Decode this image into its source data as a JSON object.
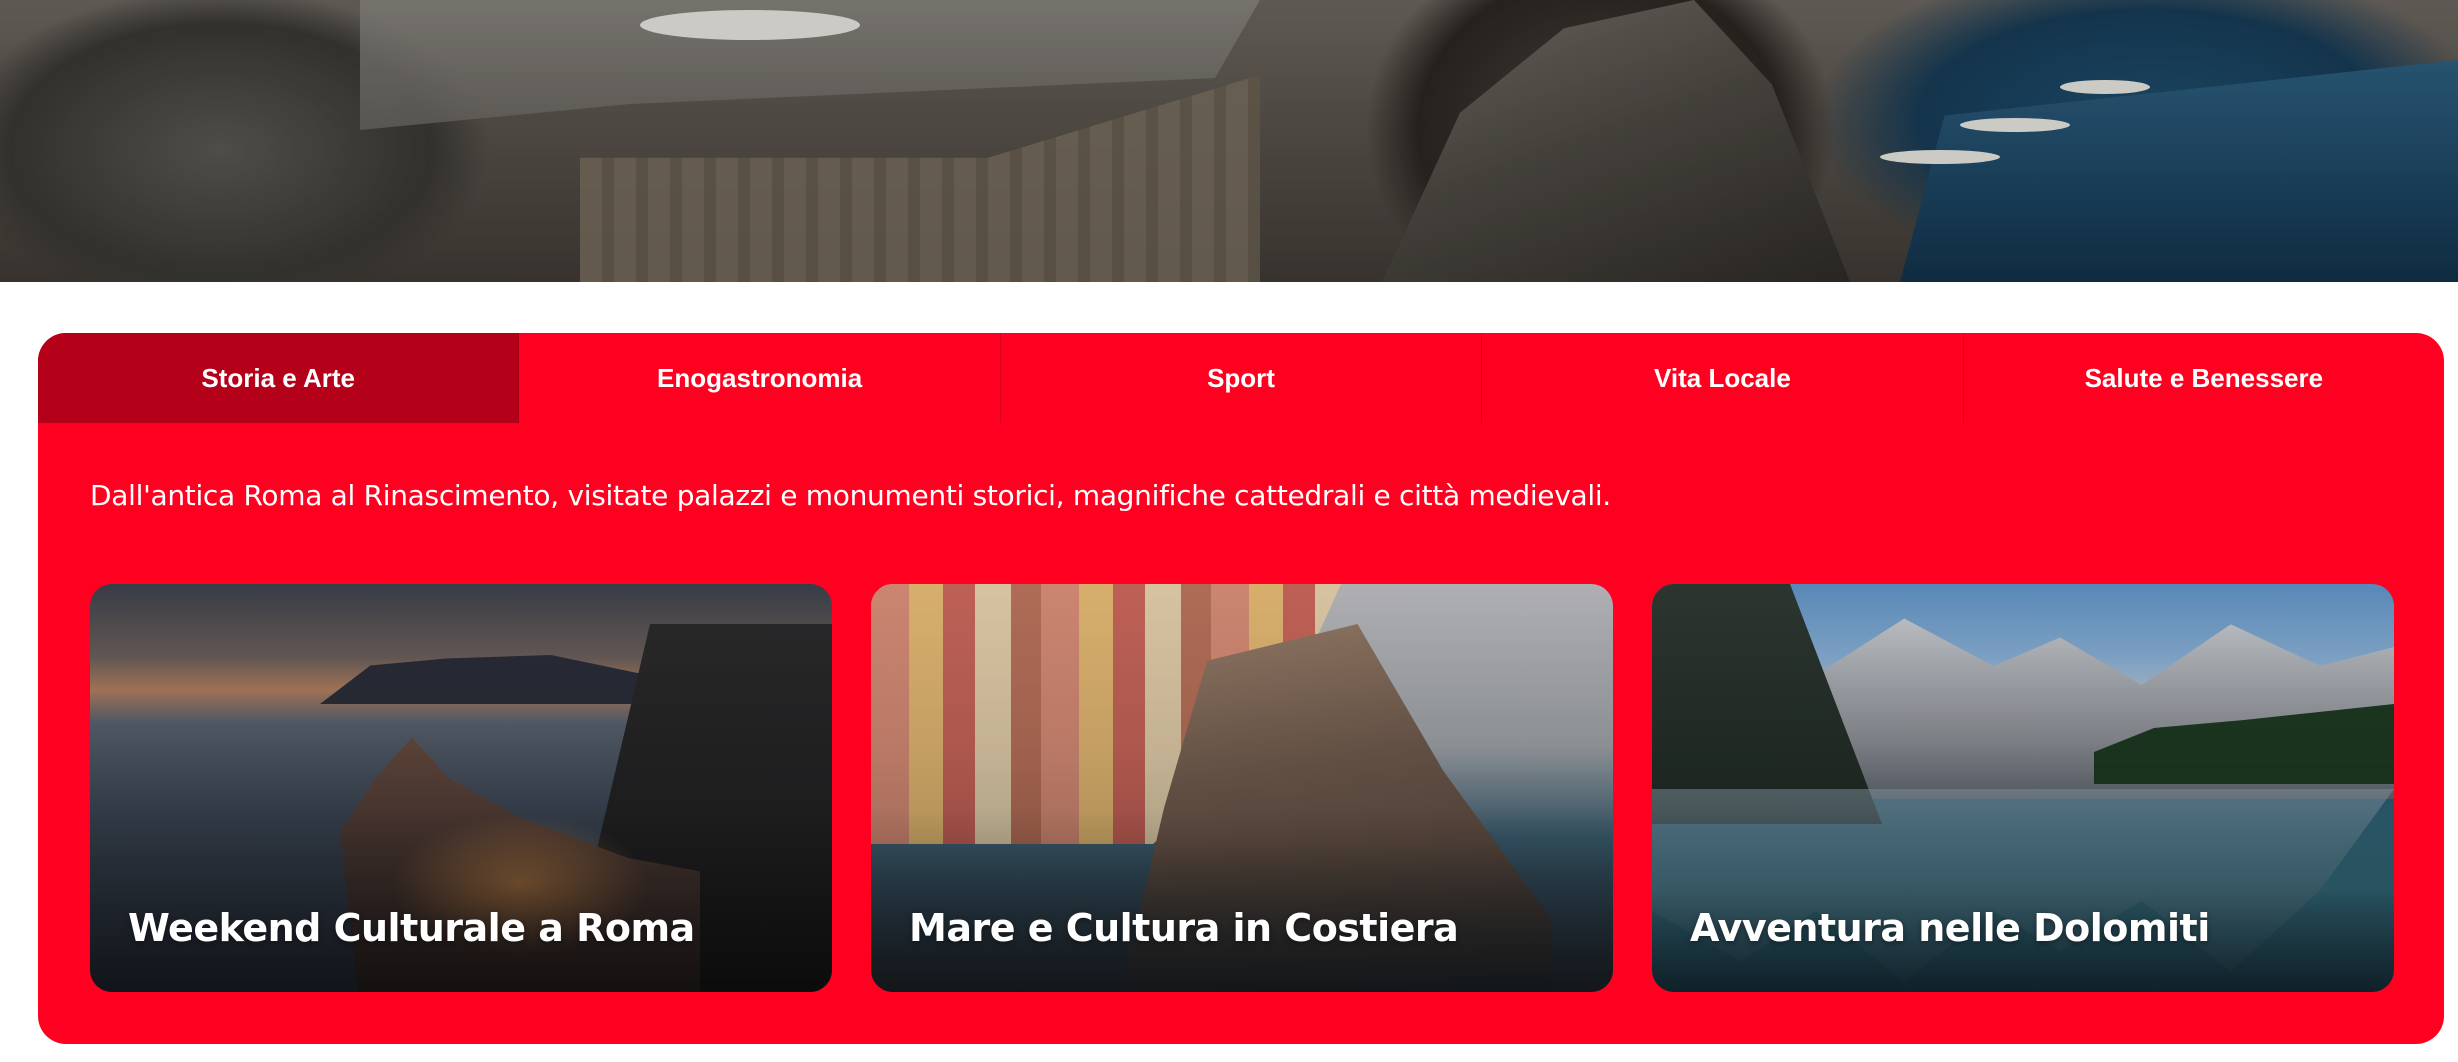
{
  "tabs": [
    {
      "label": "Storia e Arte",
      "active": true
    },
    {
      "label": "Enogastronomia",
      "active": false
    },
    {
      "label": "Sport",
      "active": false
    },
    {
      "label": "Vita Locale",
      "active": false
    },
    {
      "label": "Salute e Benessere",
      "active": false
    }
  ],
  "intro": "Dall'antica Roma al Rinascimento, visitate palazzi e monumenti storici, magnifiche cattedrali e città medievali.",
  "cards": [
    {
      "title": "Weekend Culturale a Roma"
    },
    {
      "title": "Mare e Cultura in Costiera"
    },
    {
      "title": "Avventura nelle Dolomiti"
    }
  ],
  "colors": {
    "panel": "#ff0020",
    "active_tab": "#b50019",
    "text": "#ffffff"
  }
}
